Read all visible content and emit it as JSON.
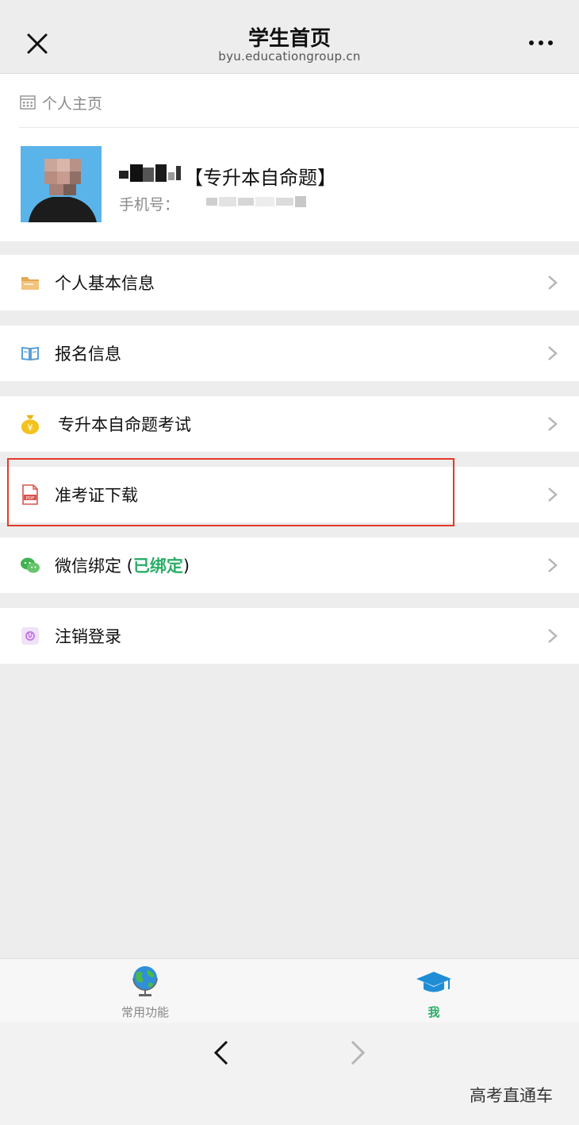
{
  "header": {
    "title": "学生首页",
    "url": "byu.educationgroup.cn"
  },
  "profile": {
    "section_title": "个人主页",
    "name_suffix": "【专升本自命题】",
    "phone_label": "手机号："
  },
  "menu": [
    {
      "label": "个人基本信息",
      "icon": "folder-icon"
    },
    {
      "label": "报名信息",
      "icon": "book-icon"
    },
    {
      "label": "专升本自命题考试",
      "icon": "money-bag-icon"
    },
    {
      "label": "准考证下载",
      "icon": "pdf-icon"
    },
    {
      "label": "微信绑定 (",
      "status": "已绑定",
      "suffix": ")",
      "icon": "wechat-icon"
    },
    {
      "label": "注销登录",
      "icon": "power-icon"
    }
  ],
  "tabs": [
    {
      "label": "常用功能",
      "icon": "globe-icon",
      "active": false
    },
    {
      "label": "我",
      "icon": "graduation-cap-icon",
      "active": true
    }
  ],
  "colors": {
    "highlight": "#e5382a",
    "active_tab": "#2aae67",
    "bound_status": "#2aae67"
  },
  "watermark": "高考直通车"
}
